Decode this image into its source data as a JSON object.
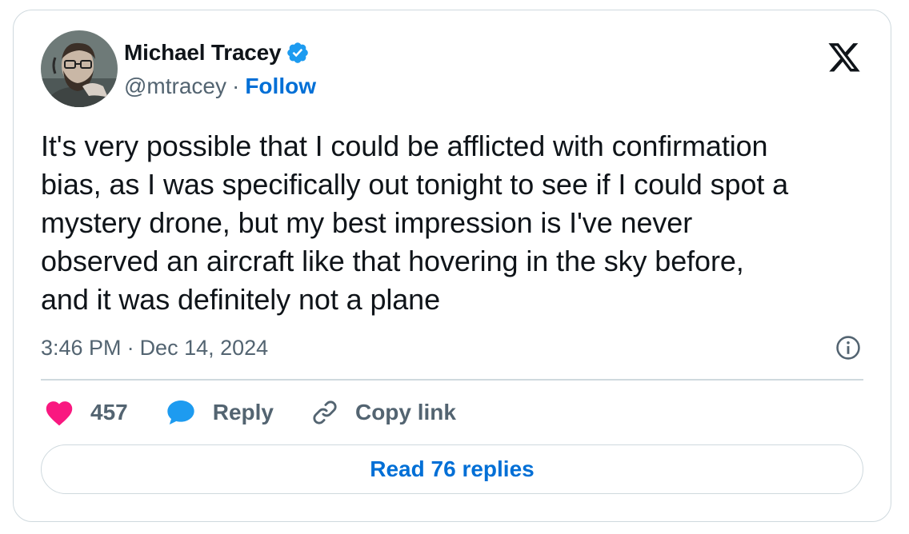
{
  "author": {
    "name": "Michael Tracey",
    "handle": "@mtracey",
    "separator": "·",
    "follow_label": "Follow",
    "verified": true,
    "verified_color": "#1d9bf0"
  },
  "tweet": {
    "text": "It's very possible that I could be afflicted with confirmation\nbias, as I was specifically out tonight to see if I could spot a\nmystery drone, but my best impression is I've never\nobserved an aircraft like that hovering in the sky before,\nand it was definitely not a plane",
    "time": "3:46 PM",
    "separator": "·",
    "date": "Dec 14, 2024"
  },
  "actions": {
    "likes_count": "457",
    "reply_label": "Reply",
    "copy_link_label": "Copy link"
  },
  "read_replies_label": "Read 76 replies",
  "colors": {
    "accent": "#006fd6",
    "heart": "#f91880",
    "reply_bubble": "#1d9bf0",
    "muted": "#536471",
    "border": "#cfd9de"
  },
  "icons": [
    "x-logo-icon",
    "verified-badge-icon",
    "info-icon",
    "heart-icon",
    "reply-bubble-icon",
    "link-icon"
  ]
}
